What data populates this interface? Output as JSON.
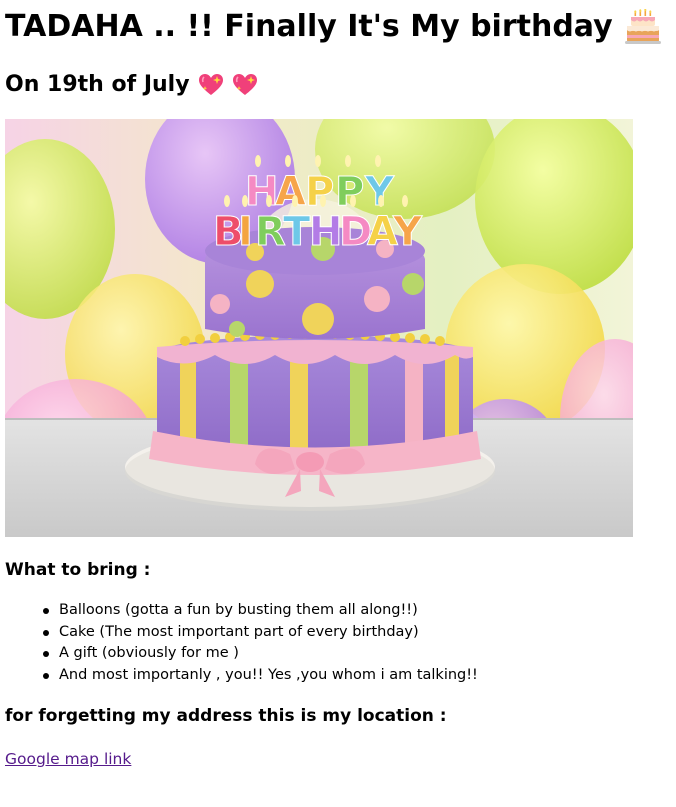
{
  "heading": {
    "title": "TADAHA .. !! Finally It's My birthday",
    "title_emoji": "birthday-cake",
    "date": "On 19th of July",
    "date_emojis": [
      "sparkling-heart",
      "sparkling-heart"
    ]
  },
  "image": {
    "cake_letters_top": "HAPPY",
    "cake_letters_bottom": "BIRTHDAY"
  },
  "bring": {
    "heading": "What to bring :",
    "items": [
      "Balloons (gotta a fun by busting them all along!!)",
      "Cake (The most important part of every birthday)",
      "A gift (obviously for me )",
      "And most importanly , you!! Yes ,you whom i am talking!!"
    ]
  },
  "location": {
    "heading": "for forgetting my address this is my location :",
    "link_text": "Google map link"
  },
  "colors": {
    "link": "#551a8b",
    "text": "#000000"
  }
}
